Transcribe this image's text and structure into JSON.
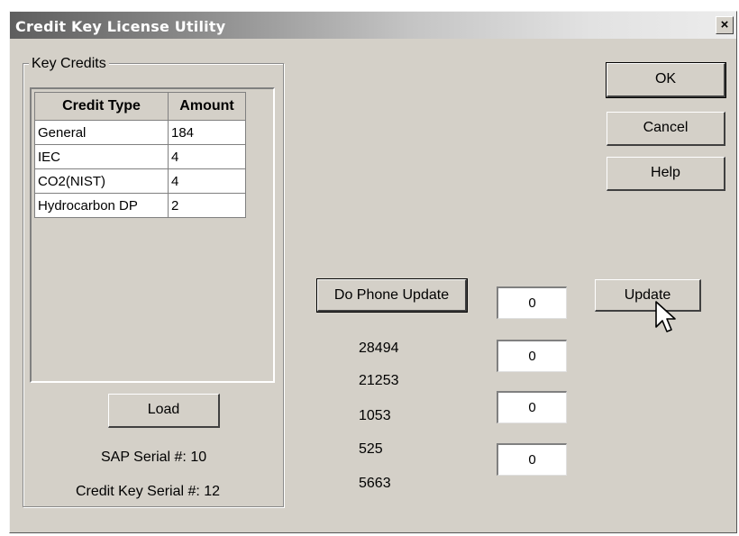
{
  "window": {
    "title": "Credit Key License Utility",
    "close_label": "×"
  },
  "group": {
    "legend": "Key Credits"
  },
  "table": {
    "headers": [
      "Credit Type",
      "Amount"
    ],
    "rows": [
      {
        "type": "General",
        "amount": "184"
      },
      {
        "type": "IEC",
        "amount": "4"
      },
      {
        "type": "CO2(NIST)",
        "amount": "4"
      },
      {
        "type": "Hydrocarbon DP",
        "amount": "2"
      }
    ]
  },
  "buttons": {
    "ok": "OK",
    "cancel": "Cancel",
    "help": "Help",
    "load": "Load",
    "phone_update": "Do Phone Update",
    "update": "Update"
  },
  "serials": {
    "sap": "SAP Serial #: 10",
    "credit_key": "Credit Key Serial #: 12"
  },
  "phone_codes": [
    "28494",
    "21253",
    "1053",
    "525",
    "5663"
  ],
  "fields": [
    "0",
    "0",
    "0",
    "0"
  ],
  "icons": {
    "cursor": "mouse-pointer-icon"
  }
}
